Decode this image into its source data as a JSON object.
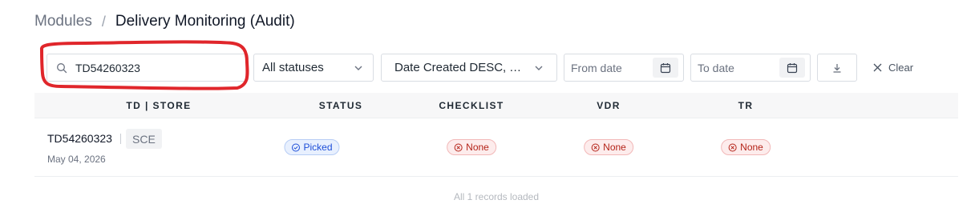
{
  "breadcrumb": {
    "parent": "Modules",
    "separator": "/",
    "current": "Delivery Monitoring (Audit)"
  },
  "toolbar": {
    "search": {
      "value": "TD54260323",
      "icon": "search-icon"
    },
    "status_select": {
      "value": "All statuses",
      "icon": "chevron-down-icon"
    },
    "sort_select": {
      "value": "Date Created DESC, T...",
      "icon": "chevron-down-icon"
    },
    "from_date": {
      "placeholder": "From date",
      "icon": "calendar-icon"
    },
    "to_date": {
      "placeholder": "To date",
      "icon": "calendar-icon"
    },
    "download": {
      "icon": "download-icon"
    },
    "clear": {
      "label": "Clear",
      "icon": "close-icon"
    }
  },
  "annotation": {
    "color": "#e0262b"
  },
  "table": {
    "columns": [
      "TD | STORE",
      "STATUS",
      "CHECKLIST",
      "VDR",
      "TR"
    ],
    "rows": [
      {
        "td": "TD54260323",
        "store": "SCE",
        "date": "May 04, 2026",
        "status": "Picked",
        "checklist": "None",
        "vdr": "None",
        "tr": "None"
      }
    ]
  },
  "footer": {
    "records_text": "All 1 records loaded"
  },
  "colors": {
    "picked": "#1d4ed8",
    "none": "#b42318",
    "header_bg": "#f7f7f8"
  }
}
